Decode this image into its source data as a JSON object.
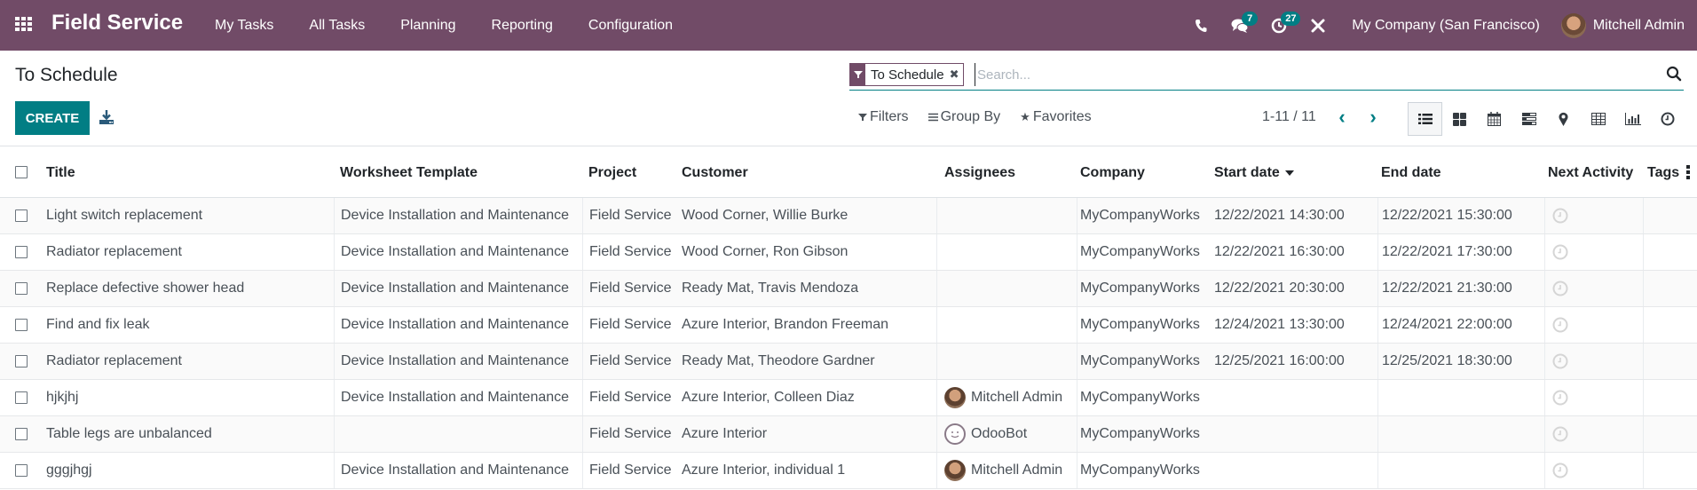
{
  "navbar": {
    "app_name": "Field Service",
    "menu": [
      "My Tasks",
      "All Tasks",
      "Planning",
      "Reporting",
      "Configuration"
    ],
    "messages_count": "7",
    "activities_count": "27",
    "company": "My Company (San Francisco)",
    "user": "Mitchell Admin",
    "brand_color": "#714B67"
  },
  "control_panel": {
    "title": "To Schedule",
    "create_label": "CREATE",
    "search": {
      "facet_label": "To Schedule",
      "placeholder": "Search..."
    },
    "filters_label": "Filters",
    "group_by_label": "Group By",
    "favorites_label": "Favorites",
    "pager": "1-11 / 11",
    "views": [
      "list",
      "kanban",
      "calendar",
      "gantt",
      "map",
      "pivot",
      "graph",
      "activity"
    ],
    "active_view": "list",
    "accent_color": "#017e84"
  },
  "table": {
    "columns": [
      "Title",
      "Worksheet Template",
      "Project",
      "Customer",
      "Assignees",
      "Company",
      "Start date",
      "End date",
      "Next Activity",
      "Tags"
    ],
    "sorted_column": "Start date",
    "rows": [
      {
        "title": "Light switch replacement",
        "worksheet": "Device Installation and Maintenance",
        "project": "Field Service",
        "customer": "Wood Corner, Willie Burke",
        "assignee": "",
        "assignee_avatar": "",
        "company": "MyCompanyWorks",
        "start": "12/22/2021 14:30:00",
        "end": "12/22/2021 15:30:00"
      },
      {
        "title": "Radiator replacement",
        "worksheet": "Device Installation and Maintenance",
        "project": "Field Service",
        "customer": "Wood Corner, Ron Gibson",
        "assignee": "",
        "assignee_avatar": "",
        "company": "MyCompanyWorks",
        "start": "12/22/2021 16:30:00",
        "end": "12/22/2021 17:30:00"
      },
      {
        "title": "Replace defective shower head",
        "worksheet": "Device Installation and Maintenance",
        "project": "Field Service",
        "customer": "Ready Mat, Travis Mendoza",
        "assignee": "",
        "assignee_avatar": "",
        "company": "MyCompanyWorks",
        "start": "12/22/2021 20:30:00",
        "end": "12/22/2021 21:30:00"
      },
      {
        "title": "Find and fix leak",
        "worksheet": "Device Installation and Maintenance",
        "project": "Field Service",
        "customer": "Azure Interior, Brandon Freeman",
        "assignee": "",
        "assignee_avatar": "",
        "company": "MyCompanyWorks",
        "start": "12/24/2021 13:30:00",
        "end": "12/24/2021 22:00:00"
      },
      {
        "title": "Radiator replacement",
        "worksheet": "Device Installation and Maintenance",
        "project": "Field Service",
        "customer": "Ready Mat, Theodore Gardner",
        "assignee": "",
        "assignee_avatar": "",
        "company": "MyCompanyWorks",
        "start": "12/25/2021 16:00:00",
        "end": "12/25/2021 18:30:00"
      },
      {
        "title": "hjkjhj",
        "worksheet": "Device Installation and Maintenance",
        "project": "Field Service",
        "customer": "Azure Interior, Colleen Diaz",
        "assignee": "Mitchell Admin",
        "assignee_avatar": "person",
        "company": "MyCompanyWorks",
        "start": "",
        "end": ""
      },
      {
        "title": "Table legs are unbalanced",
        "worksheet": "",
        "project": "Field Service",
        "customer": "Azure Interior",
        "assignee": "OdooBot",
        "assignee_avatar": "bot",
        "company": "MyCompanyWorks",
        "start": "",
        "end": ""
      },
      {
        "title": "gggjhgj",
        "worksheet": "Device Installation and Maintenance",
        "project": "Field Service",
        "customer": "Azure Interior, individual 1",
        "assignee": "Mitchell Admin",
        "assignee_avatar": "person",
        "company": "MyCompanyWorks",
        "start": "",
        "end": ""
      }
    ]
  }
}
